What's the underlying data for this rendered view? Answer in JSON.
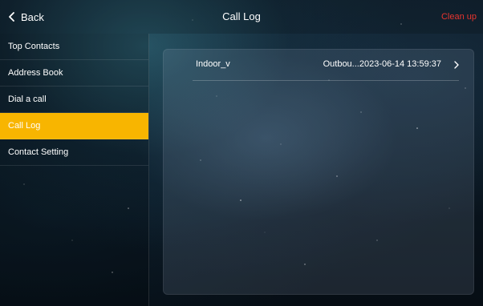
{
  "header": {
    "back_label": "Back",
    "title": "Call Log",
    "cleanup_label": "Clean up"
  },
  "sidebar": {
    "items": [
      {
        "label": "Top Contacts",
        "active": false
      },
      {
        "label": "Address Book",
        "active": false
      },
      {
        "label": "Dial a call",
        "active": false
      },
      {
        "label": "Call Log",
        "active": true
      },
      {
        "label": "Contact Setting",
        "active": false
      }
    ]
  },
  "call_log": {
    "entries": [
      {
        "name": "Indoor_v",
        "detail": "Outbou...2023-06-14 13:59:37"
      }
    ]
  },
  "colors": {
    "accent": "#f8b500",
    "cleanup": "#e8342e"
  },
  "icons": {
    "back": "chevron-left-icon",
    "row_arrow": "chevron-right-icon"
  }
}
